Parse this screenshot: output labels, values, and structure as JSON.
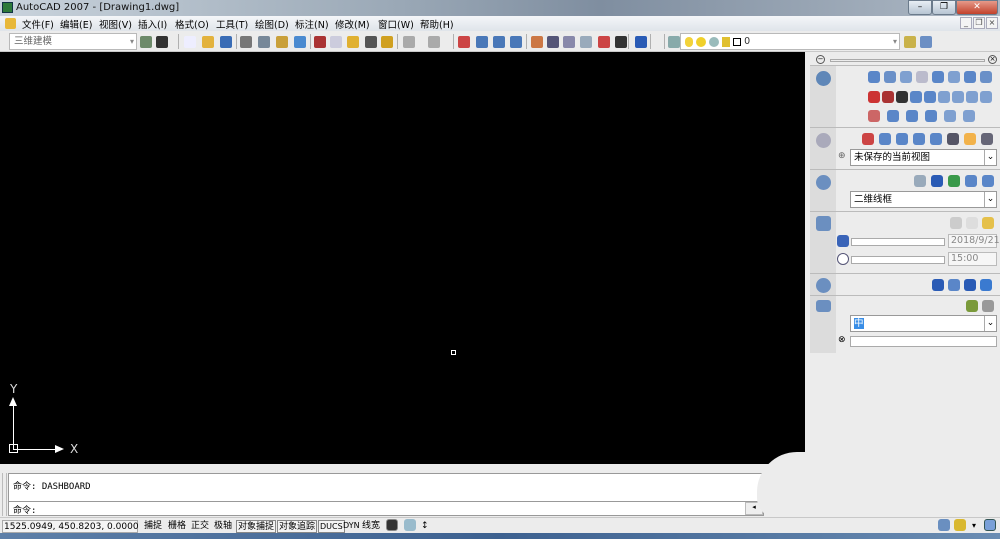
{
  "window": {
    "title": "AutoCAD 2007 - [Drawing1.dwg]",
    "minimize": "–",
    "restore": "❐",
    "close": "✕"
  },
  "menu": [
    "文件(F)",
    "编辑(E)",
    "视图(V)",
    "插入(I)",
    "格式(O)",
    "工具(T)",
    "绘图(D)",
    "标注(N)",
    "修改(M)",
    "窗口(W)",
    "帮助(H)"
  ],
  "mdi": {
    "minimize": "_",
    "restore": "❐",
    "close": "×"
  },
  "toolbar": {
    "workspace": "三维建模",
    "layer": "0",
    "icons": [
      "workspace-settings-icon",
      "workspace-icon",
      "new-icon",
      "open-icon",
      "save-icon",
      "plot-icon",
      "plot-preview-icon",
      "publish-icon",
      "3d-dwf-icon",
      "cut-icon",
      "copy-icon",
      "paste-icon",
      "match-properties-icon",
      "block-editor-icon",
      "undo-icon",
      "redo-icon",
      "pan-icon",
      "zoom-realtime-icon",
      "zoom-window-icon",
      "zoom-previous-icon",
      "properties-icon",
      "design-center-icon",
      "tool-palettes-icon",
      "sheet-set-icon",
      "markup-icon",
      "quickcalc-icon",
      "help-icon"
    ]
  },
  "axes": {
    "y": "Y",
    "x": "X"
  },
  "panel": {
    "view_combo": "未保存的当前视图",
    "visual_style": "二维线框",
    "date": "2018/9/21",
    "time": "15:00",
    "material_combo": "中",
    "sun_slider": 0.0,
    "time_slider": 0.0
  },
  "command": {
    "history": "命令: DASHBOARD",
    "prompt": "命令:"
  },
  "status": {
    "coords": "1525.0949,  450.8203,  0.0000",
    "toggles": [
      {
        "label": "捕捉",
        "on": false
      },
      {
        "label": "栅格",
        "on": false
      },
      {
        "label": "正交",
        "on": false
      },
      {
        "label": "极轴",
        "on": false
      },
      {
        "label": "对象捕捉",
        "on": true
      },
      {
        "label": "对象追踪",
        "on": true
      },
      {
        "label": "DUCS",
        "on": true
      },
      {
        "label": "DYN",
        "on": false
      },
      {
        "label": "线宽",
        "on": false
      }
    ]
  }
}
